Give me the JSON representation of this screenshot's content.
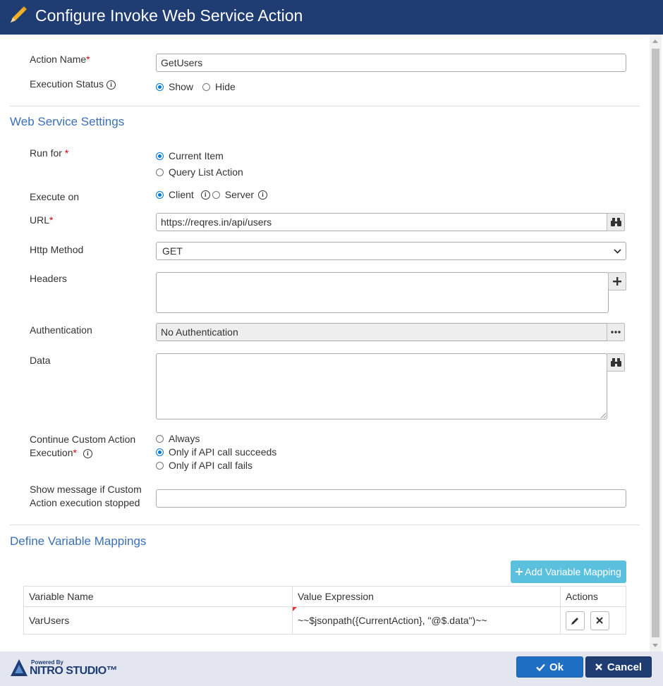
{
  "dialog": {
    "title": "Configure Invoke Web Service Action"
  },
  "action": {
    "name_label": "Action Name",
    "required_mark": "*",
    "name_value": "GetUsers",
    "execution_status_label": "Execution Status",
    "status_options": [
      "Show",
      "Hide"
    ],
    "status_selected": "Show"
  },
  "web_service": {
    "section_title": "Web Service Settings",
    "run_for_label": "Run for",
    "run_for_options": [
      "Current Item",
      "Query List Action"
    ],
    "run_for_selected": "Current Item",
    "execute_on_label": "Execute on",
    "execute_on_options": [
      "Client",
      "Server"
    ],
    "execute_on_selected": "Client",
    "url_label": "URL",
    "url_value": "https://reqres.in/api/users",
    "http_method_label": "Http Method",
    "http_method_value": "GET",
    "headers_label": "Headers",
    "headers_value": "",
    "authentication_label": "Authentication",
    "authentication_value": "No Authentication",
    "data_label": "Data",
    "data_value": "",
    "continue_label_line1": "Continue Custom Action",
    "continue_label_line2": "Execution",
    "continue_options": [
      "Always",
      "Only if API call succeeds",
      "Only if API call fails"
    ],
    "continue_selected": "Only if API call succeeds",
    "show_message_label_line1": "Show message if Custom",
    "show_message_label_line2": "Action execution stopped",
    "show_message_value": ""
  },
  "mappings": {
    "section_title": "Define Variable Mappings",
    "add_button_label": "Add Variable Mapping",
    "columns": [
      "Variable Name",
      "Value Expression",
      "Actions"
    ],
    "rows": [
      {
        "variable_name": "VarUsers",
        "value_expression": "~~$jsonpath({CurrentAction}, \"@$.data\")~~"
      }
    ]
  },
  "footer": {
    "powered_by": "Powered By",
    "brand": "NITRO STUDIO™",
    "ok_label": "Ok",
    "cancel_label": "Cancel"
  },
  "colors": {
    "header_bg": "#1f3c73",
    "section_title": "#3b70b8",
    "required": "#dd0000",
    "add_button": "#5bc0de",
    "ok_button": "#1f6fc5",
    "cancel_button": "#1f3c73"
  },
  "icons": [
    "pencil-icon",
    "info-icon",
    "binoculars-icon",
    "plus-icon",
    "ellipsis-icon",
    "chevron-down-icon",
    "edit-icon",
    "delete-icon",
    "check-icon",
    "close-icon"
  ]
}
